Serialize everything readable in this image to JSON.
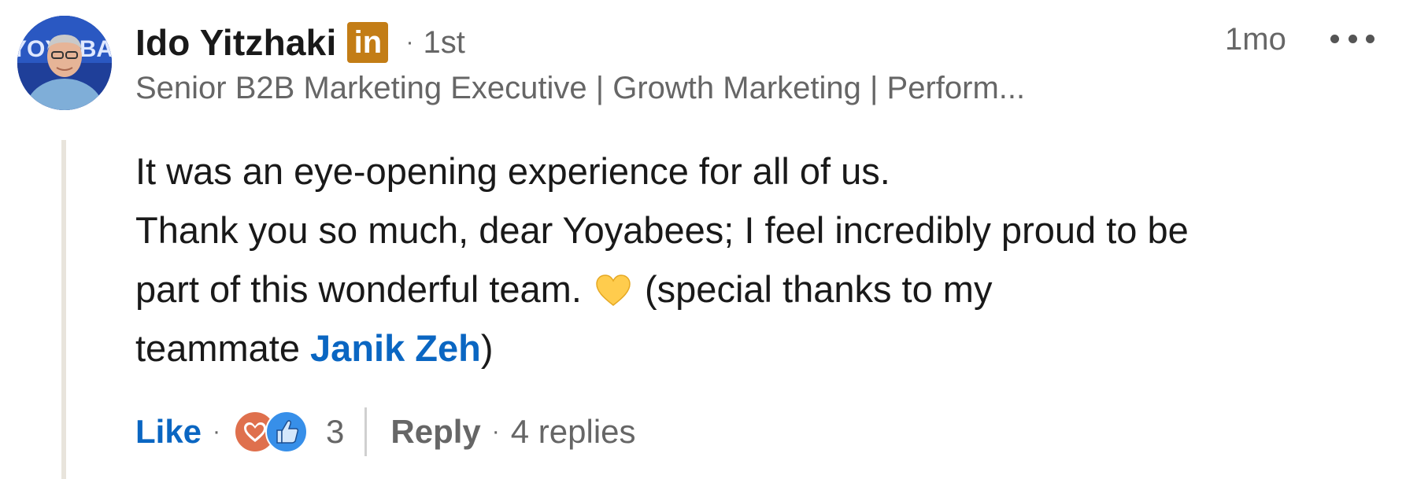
{
  "author": {
    "name": "Ido Yitzhaki",
    "badge_text": "in",
    "separator": "·",
    "degree": "1st",
    "headline": "Senior B2B Marketing Executive | Growth Marketing | Perform...",
    "avatar_text": "YOYOBA",
    "avatar_icon": "profile-photo"
  },
  "timestamp": "1mo",
  "more_icon": "three-dots-horizontal-icon",
  "comment": {
    "line1": "It was an eye-opening experience for all of us.",
    "line2": "Thank you so much, dear Yoyabees; I feel incredibly proud to be",
    "line3_before": "part of this wonderful team. ",
    "line3_emoji": "yellow-heart-icon",
    "line3_after": " (special thanks to my",
    "line4_before": "teammate ",
    "mention": "Janik Zeh",
    "line4_after": ")"
  },
  "actions": {
    "like_label": "Like",
    "dot": "·",
    "reactions": [
      "love-icon",
      "like-thumb-icon"
    ],
    "reaction_count": "3",
    "reply_label": "Reply",
    "replies_label": "4 replies"
  },
  "colors": {
    "link_blue": "#0a66c2",
    "badge_gold": "#c37d16",
    "muted_gray": "#666666",
    "thread_line": "#e8e4dc",
    "love_orange": "#df704d",
    "like_blue": "#378fe9",
    "heart_yellow": "#ffcc4d"
  }
}
